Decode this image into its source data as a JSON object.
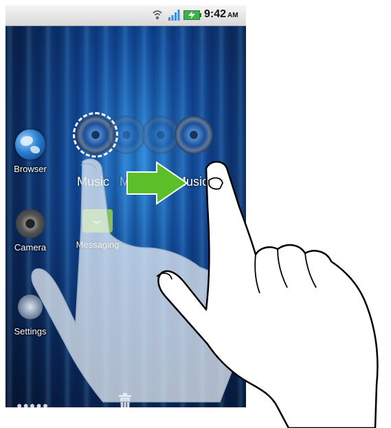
{
  "status_bar": {
    "time": "9:42",
    "ampm": "AM",
    "icons": [
      "wifi-icon",
      "signal-icon",
      "battery-charging-icon"
    ]
  },
  "home": {
    "apps": [
      {
        "label": "Browser",
        "icon": "globe-icon"
      },
      {
        "label": "Camera",
        "icon": "camera-icon"
      },
      {
        "label": "Settings",
        "icon": "gear-icon"
      },
      {
        "label": "Messaging",
        "icon": "messaging-icon"
      }
    ],
    "dragged_widget": {
      "label": "Music",
      "ghost_labels": [
        "Music",
        "Music",
        "Music"
      ],
      "icon": "speaker-icon"
    },
    "dock": {
      "left_icon": "app-drawer-dots-icon",
      "center_icon": "trash-icon"
    }
  },
  "gesture": {
    "arrow_color": "#5bbf2a",
    "direction": "right",
    "hint": "two-finger-drag"
  }
}
